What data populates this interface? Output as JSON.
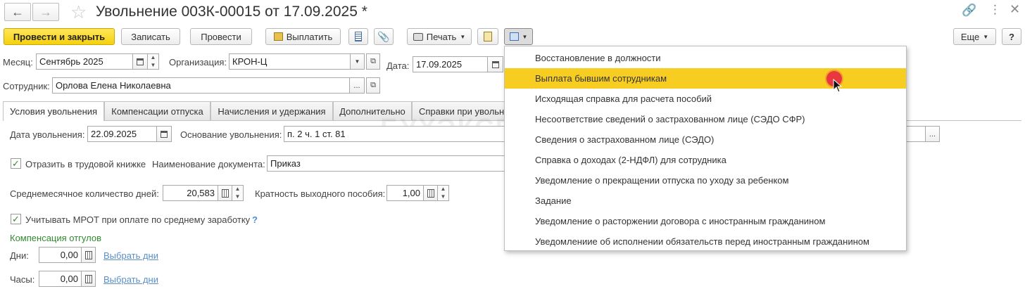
{
  "window": {
    "title": "Увольнение 003К-00015 от 17.09.2025 *"
  },
  "toolbar": {
    "post_close": "Провести и закрыть",
    "save": "Записать",
    "post": "Провести",
    "pay": "Выплатить",
    "print": "Печать",
    "more": "Еще",
    "help": "?"
  },
  "header": {
    "month_label": "Месяц:",
    "month_value": "Сентябрь 2025",
    "org_label": "Организация:",
    "org_value": "КРОН-Ц",
    "date_label": "Дата:",
    "date_value": "17.09.2025",
    "employee_label": "Сотрудник:",
    "employee_value": "Орлова Елена Николаевна"
  },
  "tabs": [
    {
      "label": "Условия увольнения"
    },
    {
      "label": "Компенсации отпуска"
    },
    {
      "label": "Начисления и удержания"
    },
    {
      "label": "Дополнительно"
    },
    {
      "label": "Справки при увольн"
    }
  ],
  "conditions": {
    "dismissal_date_label": "Дата увольнения:",
    "dismissal_date_value": "22.09.2025",
    "basis_label": "Основание увольнения:",
    "basis_value": "п. 2 ч. 1 ст. 81",
    "reflect_label": "Отразить в трудовой книжке",
    "doc_name_label": "Наименование документа:",
    "doc_name_value": "Приказ",
    "avg_days_label": "Среднемесячное количество дней:",
    "avg_days_value": "20,583",
    "multiplicity_label": "Кратность выходного пособия:",
    "multiplicity_value": "1,00",
    "mrot_label": "Учитывать МРОТ при оплате по среднему заработку",
    "mrot_help": "?",
    "comp_title": "Компенсация отгулов",
    "days_label": "Дни:",
    "days_value": "0,00",
    "hours_label": "Часы:",
    "hours_value": "0,00",
    "select_days_link": "Выбрать дни"
  },
  "dropdown_menu": {
    "items": [
      "Восстановление в должности",
      "Выплата бывшим сотрудникам",
      "Исходящая справка для расчета пособий",
      "Несоответствие сведений о застрахованном лице (СЭДО СФР)",
      "Сведения о застрахованном лице (СЭДО)",
      "Справка о доходах (2-НДФЛ) для сотрудника",
      "Уведомление о прекращении отпуска по уходу за ребенком",
      "Задание",
      "Уведомление о расторжении договора с иностранным гражданином",
      "Уведомлениие об исполнении обязательств перед иностранным гражданином"
    ],
    "highlighted_index": 1
  },
  "watermark": "БУХЭКСПЕРТ",
  "colors": {
    "accent_yellow": "#f5d10d",
    "menu_highlight": "#f7cd22",
    "link": "#5b8fc7",
    "check_green": "#2e8b2e",
    "section_green": "#2e8b2e",
    "click_marker": "#e8373f"
  }
}
